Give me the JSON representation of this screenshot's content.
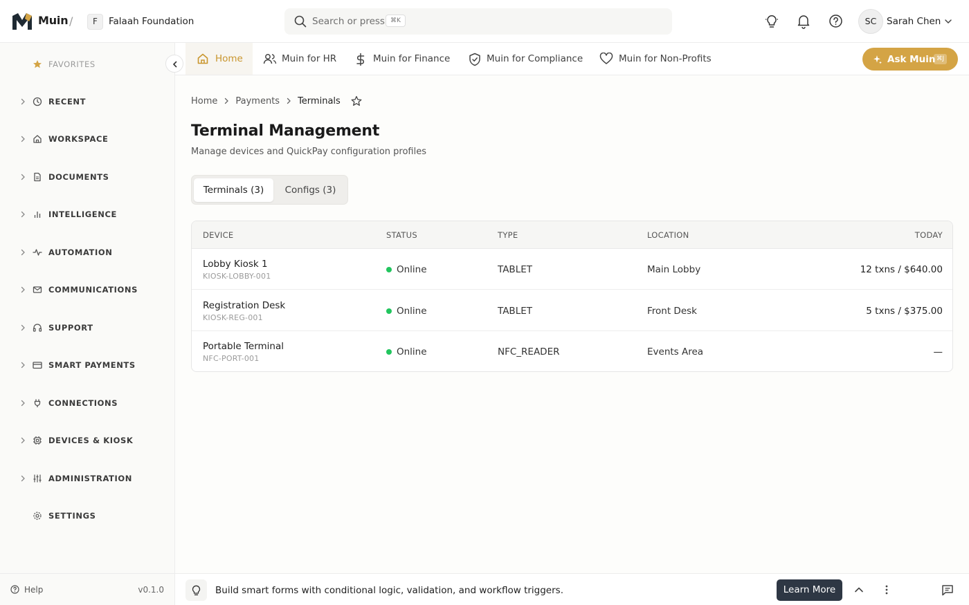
{
  "header": {
    "app_name": "Muin",
    "separator": "/",
    "org_initial": "F",
    "org_name": "Falaah Foundation",
    "search_placeholder": "Search or press",
    "search_shortcut": "⌘K",
    "user_initials": "SC",
    "user_name": "Sarah Chen"
  },
  "sidebar": {
    "items": [
      {
        "label": "FAVORITES",
        "icon": "star-icon"
      },
      {
        "label": "RECENT",
        "icon": "clock-icon"
      },
      {
        "label": "WORKSPACE",
        "icon": "home-icon"
      },
      {
        "label": "DOCUMENTS",
        "icon": "document-icon"
      },
      {
        "label": "INTELLIGENCE",
        "icon": "bar-chart-icon"
      },
      {
        "label": "AUTOMATION",
        "icon": "activity-icon"
      },
      {
        "label": "COMMUNICATIONS",
        "icon": "mail-icon"
      },
      {
        "label": "SUPPORT",
        "icon": "headset-icon"
      },
      {
        "label": "SMART PAYMENTS",
        "icon": "credit-card-icon"
      },
      {
        "label": "CONNECTIONS",
        "icon": "plug-icon"
      },
      {
        "label": "DEVICES & KIOSK",
        "icon": "cpu-icon"
      },
      {
        "label": "ADMINISTRATION",
        "icon": "sliders-icon"
      },
      {
        "label": "SETTINGS",
        "icon": "gear-icon"
      }
    ],
    "help_label": "Help",
    "version": "v0.1.0"
  },
  "modules": {
    "tabs": [
      {
        "label": "Home",
        "icon": "home-icon"
      },
      {
        "label": "Muin for HR",
        "icon": "users-icon"
      },
      {
        "label": "Muin for Finance",
        "icon": "dollar-icon"
      },
      {
        "label": "Muin for Compliance",
        "icon": "shield-check-icon"
      },
      {
        "label": "Muin for Non-Profits",
        "icon": "heart-icon"
      }
    ],
    "ask_label": "Ask Muin",
    "ask_shortcut": "⌘J"
  },
  "breadcrumb": [
    "Home",
    "Payments",
    "Terminals"
  ],
  "page": {
    "title": "Terminal Management",
    "subtitle": "Manage devices and QuickPay configuration profiles"
  },
  "segments": [
    {
      "label": "Terminals (3)",
      "active": true
    },
    {
      "label": "Configs (3)",
      "active": false
    }
  ],
  "table": {
    "columns": [
      "DEVICE",
      "STATUS",
      "TYPE",
      "LOCATION",
      "TODAY"
    ],
    "rows": [
      {
        "name": "Lobby Kiosk 1",
        "id": "KIOSK-LOBBY-001",
        "status": "Online",
        "type": "TABLET",
        "location": "Main Lobby",
        "today": "12 txns / $640.00"
      },
      {
        "name": "Registration Desk",
        "id": "KIOSK-REG-001",
        "status": "Online",
        "type": "TABLET",
        "location": "Front Desk",
        "today": "5 txns / $375.00"
      },
      {
        "name": "Portable Terminal",
        "id": "NFC-PORT-001",
        "status": "Online",
        "type": "NFC_READER",
        "location": "Events Area",
        "today": "—"
      }
    ]
  },
  "tip": {
    "text": "Build smart forms with conditional logic, validation, and workflow triggers.",
    "button": "Learn More"
  },
  "colors": {
    "accent": "#d4a445",
    "active_tab_text": "#c9962e",
    "online": "#22c55e",
    "learn_button": "#2e3744"
  }
}
